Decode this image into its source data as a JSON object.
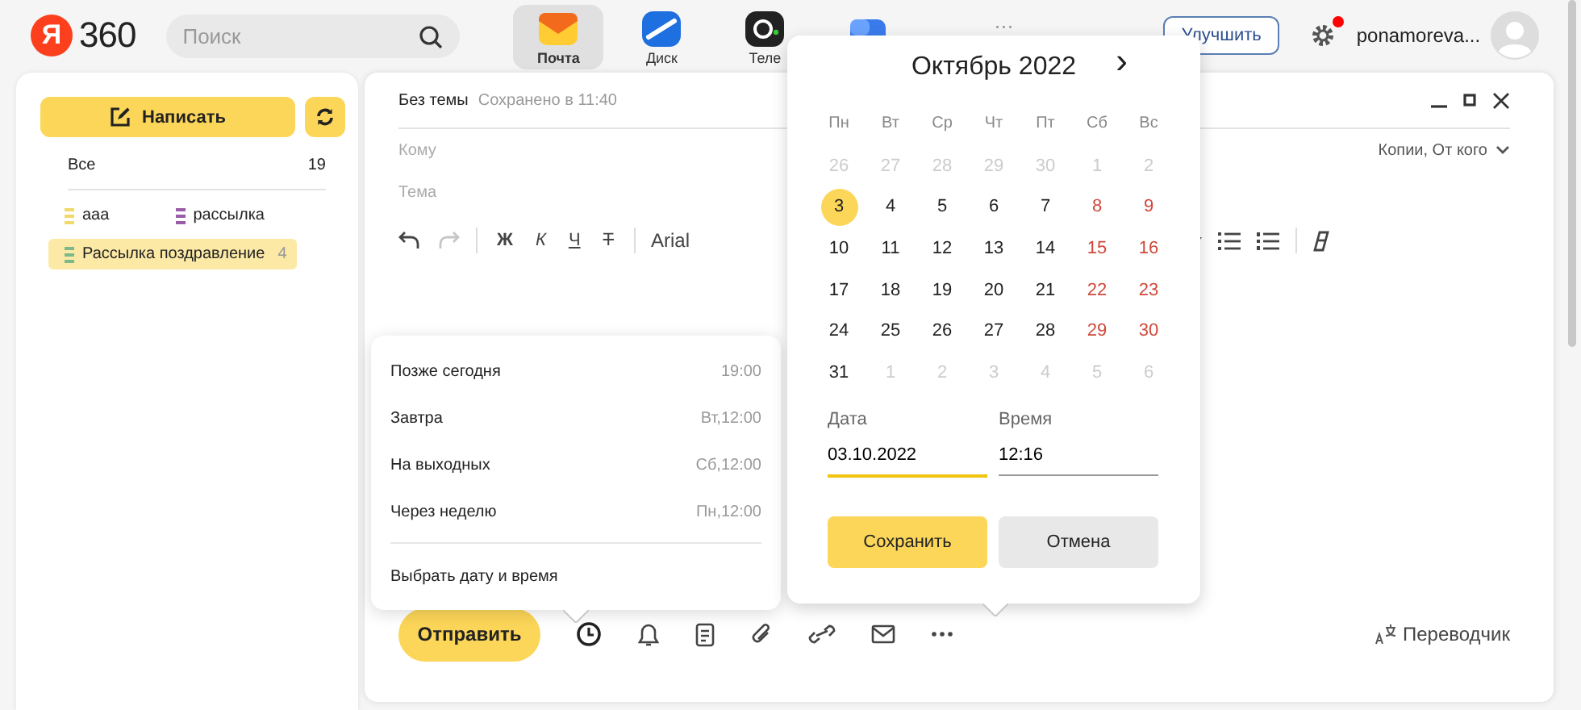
{
  "header": {
    "logo": {
      "mark": "Я",
      "text": "360"
    },
    "search": {
      "placeholder": "Поиск"
    },
    "apps": [
      {
        "label": "Почта",
        "kind": "mail",
        "selected": true
      },
      {
        "label": "Диск",
        "kind": "disk",
        "selected": false
      },
      {
        "label": "Теле",
        "kind": "telemost",
        "selected": false
      },
      {
        "kind": "docs",
        "selected": false
      }
    ],
    "more": "···",
    "upgrade_button": "Улучшить",
    "settings_notification": true,
    "username": "ponamoreva..."
  },
  "sidebar": {
    "compose_button": "Написать",
    "folders": [
      {
        "label": "Все",
        "count": "19"
      }
    ],
    "labels": [
      {
        "name": "ааа",
        "color": "#f2d96b",
        "selected": false
      },
      {
        "name": "рассылка",
        "color": "#9b5ca8",
        "selected": false
      },
      {
        "name": "Рассылка поздравление",
        "count": "4",
        "color": "#7cb98a",
        "selected": true
      }
    ]
  },
  "compose": {
    "subject_title": "Без темы",
    "saved_status": "Сохранено в 11:40",
    "to_placeholder": "Кому",
    "subject_placeholder": "Тема",
    "cc_toggle": "Копии, От кого",
    "toolbar": {
      "undo_disabled": false,
      "redo_disabled": true,
      "format_buttons": [
        "Ж",
        "К",
        "Ч",
        "Т"
      ],
      "font": "Arial"
    },
    "send_button": "Отправить",
    "translator": "Переводчик"
  },
  "schedule_menu": {
    "options": [
      {
        "label": "Позже сегодня",
        "time": "19:00"
      },
      {
        "label": "Завтра",
        "time": "Вт,12:00"
      },
      {
        "label": "На выходных",
        "time": "Сб,12:00"
      },
      {
        "label": "Через неделю",
        "time": "Пн,12:00"
      }
    ],
    "custom_option": "Выбрать дату и время"
  },
  "calendar": {
    "title": "Октябрь 2022",
    "next": "›",
    "weekdays": [
      "Пн",
      "Вт",
      "Ср",
      "Чт",
      "Пт",
      "Сб",
      "Вс"
    ],
    "weeks": [
      [
        {
          "d": "26",
          "kind": "other",
          "selected": false
        },
        {
          "d": "27",
          "kind": "other",
          "selected": false
        },
        {
          "d": "28",
          "kind": "other",
          "selected": false
        },
        {
          "d": "29",
          "kind": "other",
          "selected": false
        },
        {
          "d": "30",
          "kind": "other",
          "selected": false
        },
        {
          "d": "1",
          "kind": "other",
          "selected": false
        },
        {
          "d": "2",
          "kind": "other",
          "selected": false
        }
      ],
      [
        {
          "d": "3",
          "kind": "workday",
          "selected": true
        },
        {
          "d": "4",
          "kind": "workday",
          "selected": false
        },
        {
          "d": "5",
          "kind": "workday",
          "selected": false
        },
        {
          "d": "6",
          "kind": "workday",
          "selected": false
        },
        {
          "d": "7",
          "kind": "workday",
          "selected": false
        },
        {
          "d": "8",
          "kind": "weekend",
          "selected": false
        },
        {
          "d": "9",
          "kind": "weekend",
          "selected": false
        }
      ],
      [
        {
          "d": "10",
          "kind": "workday",
          "selected": false
        },
        {
          "d": "11",
          "kind": "workday",
          "selected": false
        },
        {
          "d": "12",
          "kind": "workday",
          "selected": false
        },
        {
          "d": "13",
          "kind": "workday",
          "selected": false
        },
        {
          "d": "14",
          "kind": "workday",
          "selected": false
        },
        {
          "d": "15",
          "kind": "weekend",
          "selected": false
        },
        {
          "d": "16",
          "kind": "weekend",
          "selected": false
        }
      ],
      [
        {
          "d": "17",
          "kind": "workday",
          "selected": false
        },
        {
          "d": "18",
          "kind": "workday",
          "selected": false
        },
        {
          "d": "19",
          "kind": "workday",
          "selected": false
        },
        {
          "d": "20",
          "kind": "workday",
          "selected": false
        },
        {
          "d": "21",
          "kind": "workday",
          "selected": false
        },
        {
          "d": "22",
          "kind": "weekend",
          "selected": false
        },
        {
          "d": "23",
          "kind": "weekend",
          "selected": false
        }
      ],
      [
        {
          "d": "24",
          "kind": "workday",
          "selected": false
        },
        {
          "d": "25",
          "kind": "workday",
          "selected": false
        },
        {
          "d": "26",
          "kind": "workday",
          "selected": false
        },
        {
          "d": "27",
          "kind": "workday",
          "selected": false
        },
        {
          "d": "28",
          "kind": "workday",
          "selected": false
        },
        {
          "d": "29",
          "kind": "weekend",
          "selected": false
        },
        {
          "d": "30",
          "kind": "weekend",
          "selected": false
        }
      ],
      [
        {
          "d": "31",
          "kind": "workday",
          "selected": false
        },
        {
          "d": "1",
          "kind": "other",
          "selected": false
        },
        {
          "d": "2",
          "kind": "other",
          "selected": false
        },
        {
          "d": "3",
          "kind": "other",
          "selected": false
        },
        {
          "d": "4",
          "kind": "other",
          "selected": false
        },
        {
          "d": "5",
          "kind": "other",
          "selected": false
        },
        {
          "d": "6",
          "kind": "other",
          "selected": false
        }
      ]
    ],
    "date_label": "Дата",
    "date_value": "03.10.2022",
    "time_label": "Время",
    "time_value": "12:16",
    "save_button": "Сохранить",
    "cancel_button": "Отмена"
  }
}
